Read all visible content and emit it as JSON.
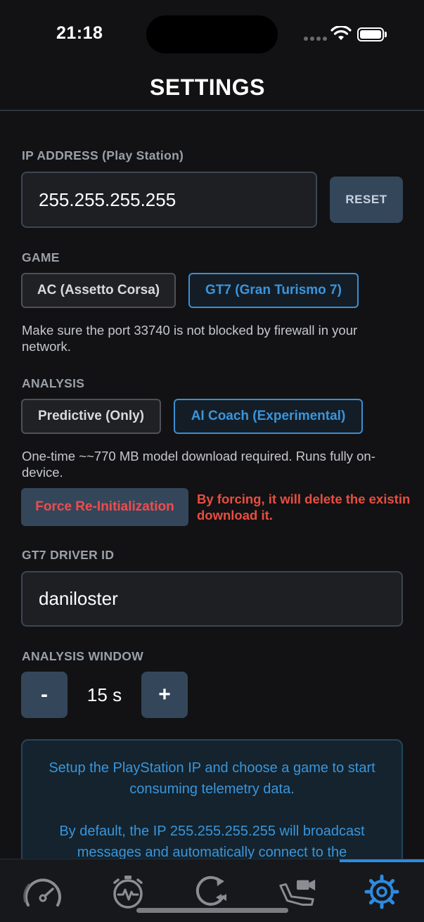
{
  "status_bar": {
    "time": "21:18"
  },
  "page": {
    "title": "SETTINGS"
  },
  "ip_section": {
    "label": "IP ADDRESS (Play Station)",
    "value": "255.255.255.255",
    "reset_label": "RESET"
  },
  "game_section": {
    "label": "GAME",
    "options": [
      {
        "label": "AC (Assetto Corsa)",
        "selected": false
      },
      {
        "label": "GT7 (Gran Turismo 7)",
        "selected": true
      }
    ],
    "note": "Make sure the port 33740 is not blocked by firewall in your network."
  },
  "analysis_section": {
    "label": "ANALYSIS",
    "options": [
      {
        "label": "Predictive (Only)",
        "selected": false
      },
      {
        "label": "AI Coach (Experimental)",
        "selected": true
      }
    ],
    "note": "One-time ~~770 MB model download required. Runs fully on-device.",
    "force_label": "Force Re-Initialization",
    "force_warning_line1": "By forcing, it will delete the existin",
    "force_warning_line2": "download it."
  },
  "driver_section": {
    "label": "GT7 DRIVER ID",
    "value": "daniloster"
  },
  "window_section": {
    "label": "ANALYSIS WINDOW",
    "minus_label": "-",
    "value": "15 s",
    "plus_label": "+"
  },
  "info": {
    "paragraph1": "Setup the PlayStation IP and choose a game to start consuming telemetry data.",
    "paragraph2": "By default, the IP 255.255.255.255 will broadcast messages and automatically connect to the"
  },
  "tab_bar": {
    "active_color": "#2d8be0",
    "inactive_color": "#8a8e94",
    "tabs": [
      {
        "icon": "speedometer-icon",
        "active": false
      },
      {
        "icon": "stopwatch-pulse-icon",
        "active": false
      },
      {
        "icon": "replay-icon",
        "active": false
      },
      {
        "icon": "seat-camera-icon",
        "active": false
      },
      {
        "icon": "gear-icon",
        "active": true
      }
    ]
  }
}
